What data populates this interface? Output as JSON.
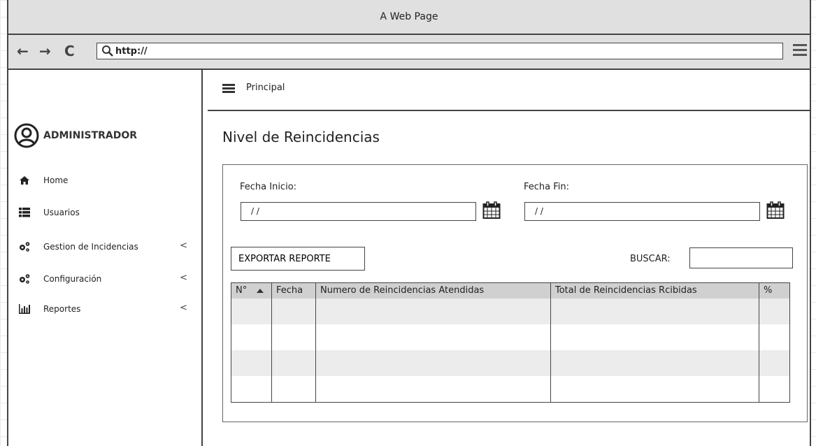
{
  "browser": {
    "title": "A Web Page",
    "url": "http://"
  },
  "sidebar": {
    "user_name": "ADMINISTRADOR",
    "items": [
      {
        "label": "Home",
        "icon": "home-icon",
        "chevron": ""
      },
      {
        "label": "Usuarios",
        "icon": "list-icon",
        "chevron": ""
      },
      {
        "label": "Gestion de Incidencias",
        "icon": "cogs-icon",
        "chevron": "<"
      },
      {
        "label": "Configuración",
        "icon": "cogs-icon",
        "chevron": "<"
      },
      {
        "label": "Reportes",
        "icon": "bar-chart-icon",
        "chevron": "<"
      }
    ]
  },
  "header": {
    "breadcrumb": "Principal"
  },
  "page": {
    "title": "Nivel de Reincidencias",
    "fecha_inicio_label": "Fecha Inicio:",
    "fecha_inicio_value": "/ /",
    "fecha_fin_label": "Fecha Fin:",
    "fecha_fin_value": "/ /",
    "export_label": "EXPORTAR REPORTE",
    "buscar_label": "BUSCAR:",
    "buscar_value": ""
  },
  "table": {
    "columns": [
      "N°",
      "Fecha",
      "Numero de Reincidencias Atendidas",
      "Total de Reincidencias Rcibidas",
      "%"
    ],
    "rows": 4
  }
}
